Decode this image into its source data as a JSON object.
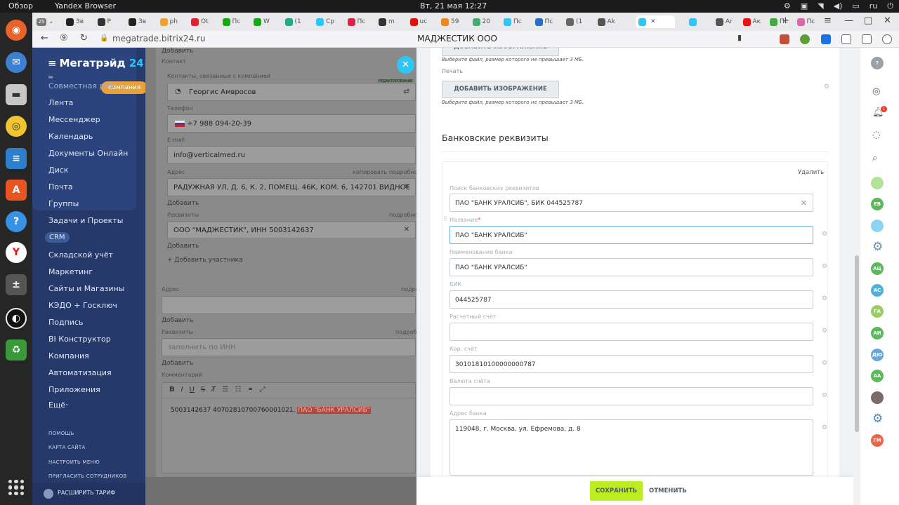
{
  "os": {
    "activities": "Обзор",
    "app": "Yandex Browser",
    "clock": "Вт, 21 мая 12:27",
    "lang": "ru"
  },
  "browser": {
    "tab_counter": "25",
    "tabs": [
      "Зв",
      "Р",
      "Зв",
      "ph",
      "Ot",
      "Пс",
      "W",
      "(1",
      "Ср",
      "Пс",
      "m",
      "uc",
      "59",
      "20",
      "Пс",
      "Пс",
      "(1",
      "Ak",
      "",
      "Ar",
      "Ак",
      "Пс",
      "Пс"
    ],
    "active_tab_label": "",
    "url": "megatrade.bitrix24.ru",
    "page_title": "МАДЖЕСТИК ООО"
  },
  "sidebar": {
    "logo_text": "Мегатрэйд",
    "logo_num": "24",
    "company_pill": "компания",
    "items": [
      "Совместная раб",
      "Лента",
      "Мессенджер",
      "Календарь",
      "Документы Онлайн",
      "Диск",
      "Почта",
      "Группы",
      "Задачи и Проекты",
      "CRM",
      "Складской учёт",
      "Маркетинг",
      "Сайты и Магазины",
      "КЭДО + Госключ",
      "Подпись",
      "BI Конструктор",
      "Компания",
      "Автоматизация",
      "Приложения",
      "Ещё"
    ],
    "small_links": [
      "помощь",
      "карта сайта",
      "настроить меню",
      "пригласить сотрудников"
    ],
    "tariff": "расширить тариф"
  },
  "bgform": {
    "add1": "Добавить",
    "contact_label": "Контакт",
    "contacts_related": "Контакты, связанные с компанией",
    "editing_badge": "РЕДАКТИРОВАНИЕ",
    "contact_name": "Георгис Амвросов",
    "phone_label": "Телефон",
    "phone": "+7 988 094-20-39",
    "email_label": "E-mail",
    "email": "info@verticalmed.ru",
    "address_label": "Адрес",
    "copy_link": "копировать",
    "detail_link": "подробно",
    "address": "РАДУЖНАЯ УЛ, Д. 6, К. 2, ПОМЕЩ. 46К, КОМ. 6, 142701 ВИДНОЕ",
    "add2": "Добавить",
    "requisites_label": "Реквизиты",
    "requisites": "ООО \"МАДЖЕСТИК\", ИНН 5003142637",
    "add3": "Добавить",
    "add_participant": "+ Добавить участника",
    "address2_label": "Адрес",
    "detail2": "подро",
    "add4": "Добавить",
    "requisites2_label": "Реквизиты",
    "detail3": "подроб",
    "inn_placeholder": "заполнить по ИНН",
    "add5": "Добавить",
    "comment_label": "Комментарий",
    "comment_text": "5003142637 40702810700760001021,",
    "comment_highlight": "ПАО \"БАНК УРАЛСИБ\""
  },
  "panel": {
    "top_button": "ДОБАВИТЬ ИЗОБРАЖЕНИЕ",
    "hint1": "Выберите файл, размер которого не превышает 3 МБ.",
    "seal_label": "Печать",
    "add_image": "ДОБАВИТЬ ИЗОБРАЖЕНИЕ",
    "hint2": "Выберите файл, размер которого не превышает 3 МБ.",
    "section_title": "Банковские реквизиты",
    "delete": "Удалить",
    "search_label": "Поиск банковских реквизитов",
    "search_value": "ПАО \"БАНК УРАЛСИБ\", БИК 044525787",
    "name_label": "Название",
    "name_value": "ПАО \"БАНК УРАЛСИБ\"",
    "bank_name_label": "Наименование банка",
    "bank_name_value": "ПАО \"БАНК УРАЛСИБ\"",
    "bik_label": "БИК",
    "bik_value": "044525787",
    "account_label": "Расчетный счёт",
    "account_value": "",
    "corr_label": "Кор. счёт",
    "corr_value": "30101810100000000787",
    "currency_label": "Валюта счёта",
    "currency_value": "",
    "bank_address_label": "Адрес банка",
    "bank_address_value": "119048, г. Москва, ул. Ефремова, д. 8",
    "save": "СОХРАНИТЬ",
    "cancel": "ОТМЕНИТЬ"
  },
  "rail": {
    "avatars": [
      "ЕВ",
      "АЦ",
      "АС",
      "ГА",
      "АИ",
      "ДЮ",
      "АА",
      "ГМ"
    ],
    "notification_count": "1"
  },
  "colors": {
    "sidebar_bg": "#25396b",
    "accent_blue": "#2fc6f6",
    "save_green": "#bbed21"
  }
}
